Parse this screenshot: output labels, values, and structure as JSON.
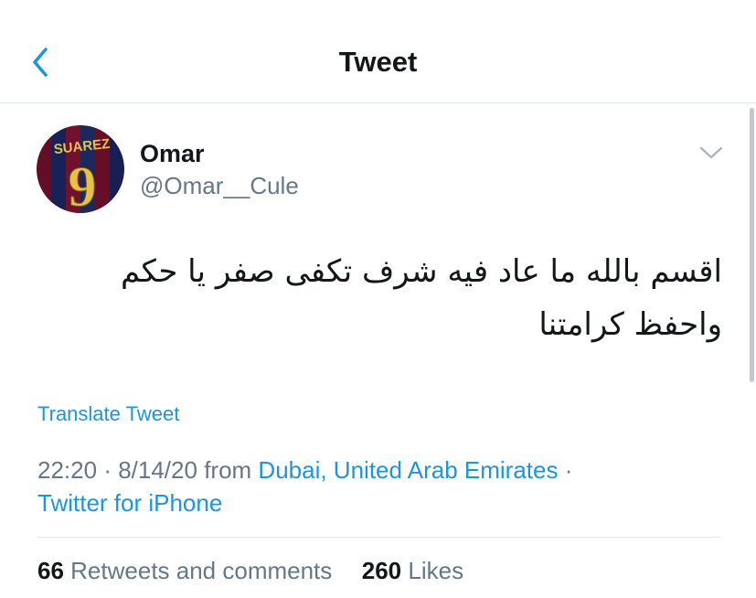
{
  "header": {
    "title": "Tweet",
    "back_icon": "chevron-left-icon"
  },
  "author": {
    "name": "Omar",
    "handle": "@Omar__Cule",
    "avatar_jersey_text": "SUAREZ",
    "avatar_jersey_number": "9"
  },
  "tweet": {
    "text_line1": "اقسم بالله ما عاد فيه شرف تكفى صفر يا حكم",
    "text_line2": "واحفظ كرامتنا",
    "translate_label": "Translate Tweet"
  },
  "meta": {
    "time": "22:20",
    "date": "8/14/20",
    "from_label": "from",
    "location": "Dubai, United Arab Emirates",
    "source": "Twitter for iPhone"
  },
  "stats": {
    "retweets_count": "66",
    "retweets_label": "Retweets and comments",
    "likes_count": "260",
    "likes_label": "Likes"
  },
  "colors": {
    "accent": "#1b95e0",
    "secondary_text": "#657786",
    "primary_text": "#14171a",
    "divider": "#e1e8ed"
  }
}
